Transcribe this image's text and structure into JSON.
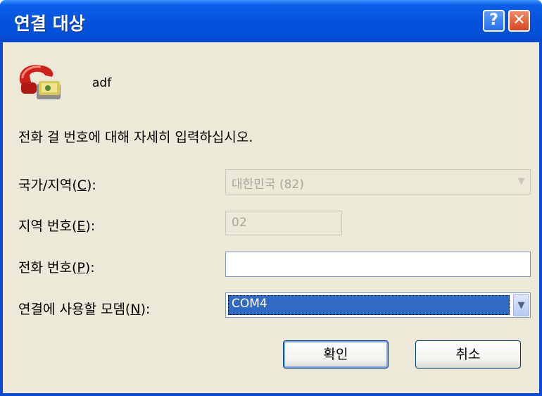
{
  "window": {
    "title": "연결 대상",
    "help_glyph": "?",
    "close_glyph": "✕"
  },
  "entry": {
    "name": "adf",
    "icon": "telephone-icon"
  },
  "instructions": "전화 걸 번호에 대해 자세히 입력하십시오.",
  "fields": {
    "country": {
      "label": "국가/지역(C):",
      "accel": "C",
      "value": "대한민국 (82)",
      "enabled": false
    },
    "area_code": {
      "label": "지역 번호(E):",
      "accel": "E",
      "value": "02",
      "enabled": false
    },
    "phone": {
      "label": "전화 번호(P):",
      "accel": "P",
      "value": "",
      "enabled": true
    },
    "modem": {
      "label": "연결에 사용할 모뎀(N):",
      "accel": "N",
      "value": "COM4",
      "enabled": true
    }
  },
  "buttons": {
    "ok": "확인",
    "cancel": "취소"
  },
  "colors": {
    "title_bar": "#0453dd",
    "dialog_bg": "#ece9d8",
    "selection": "#316ac5"
  }
}
